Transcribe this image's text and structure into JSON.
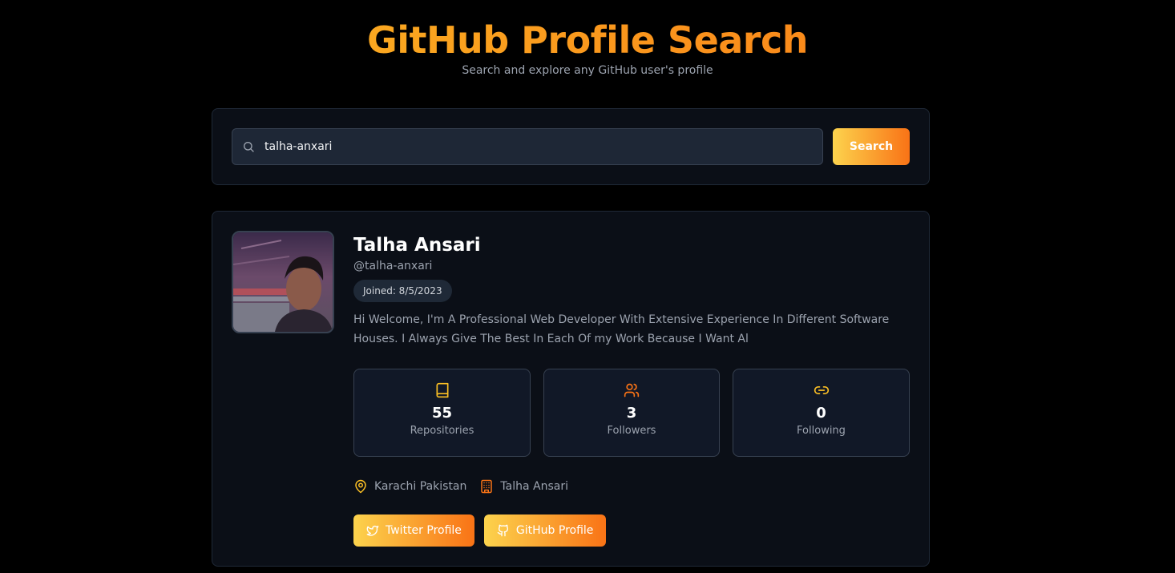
{
  "header": {
    "title": "GitHub Profile Search",
    "subtitle": "Search and explore any GitHub user's profile"
  },
  "search": {
    "value": "talha-anxari",
    "button_label": "Search",
    "icon": "search-icon"
  },
  "profile": {
    "name": "Talha Ansari",
    "login": "@talha-anxari",
    "joined": "Joined: 8/5/2023",
    "bio": "Hi Welcome, I'm A Professional Web Developer With Extensive Experience In Different Software Houses. I Always Give The Best In Each Of my Work Because I Want Al",
    "stats": [
      {
        "value": "55",
        "label": "Repositories",
        "icon": "book-icon"
      },
      {
        "value": "3",
        "label": "Followers",
        "icon": "users-icon"
      },
      {
        "value": "0",
        "label": "Following",
        "icon": "link-icon"
      }
    ],
    "location": "Karachi Pakistan",
    "company": "Talha Ansari",
    "links": {
      "twitter_label": "Twitter Profile",
      "github_label": "GitHub Profile"
    }
  },
  "colors": {
    "accent_start": "#fcd34d",
    "accent_end": "#f97316",
    "background": "#000000",
    "card": "#0b0f17"
  }
}
